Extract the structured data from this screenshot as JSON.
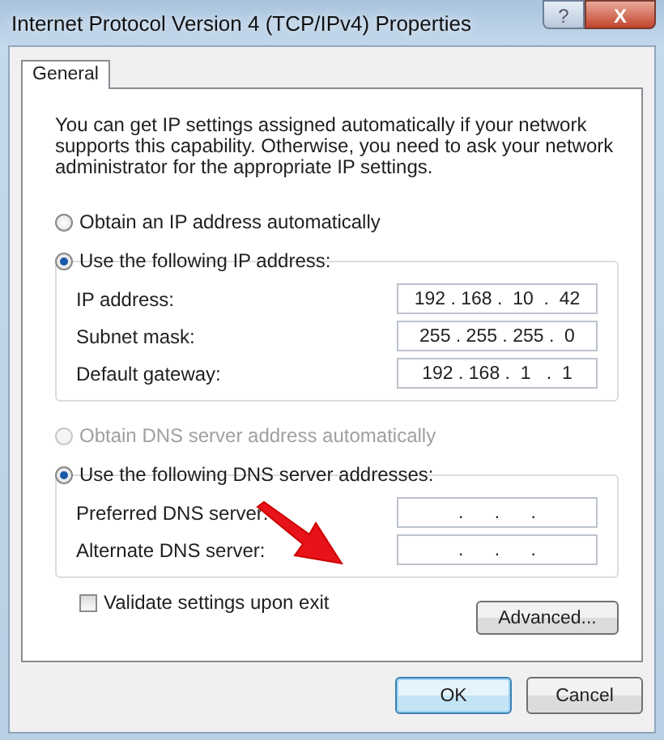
{
  "window": {
    "title": "Internet Protocol Version 4 (TCP/IPv4) Properties",
    "help": "?",
    "close": "X"
  },
  "tabs": [
    {
      "label": "General",
      "selected": true
    }
  ],
  "intro": "You can get IP settings assigned automatically if your network supports this capability. Otherwise, you need to ask your network administrator for the appropriate IP settings.",
  "sections": [
    {
      "auto_option": {
        "label": "Obtain an IP address automatically",
        "selected": false,
        "disabled": false
      },
      "manual_option": {
        "label": "Use the following IP address:",
        "selected": true
      },
      "fields": [
        {
          "label": "IP address:",
          "value": "192 . 168 .  10  .  42"
        },
        {
          "label": "Subnet mask:",
          "value": "255 . 255 . 255 .  0"
        },
        {
          "label": "Default gateway:",
          "value": "192 . 168 .  1   .  1"
        }
      ]
    },
    {
      "auto_option": {
        "label": "Obtain DNS server address automatically",
        "selected": false,
        "disabled": true
      },
      "manual_option": {
        "label": "Use the following DNS server addresses:",
        "selected": true
      },
      "fields": [
        {
          "label": "Preferred DNS server:",
          "value": ".      .      ."
        },
        {
          "label": "Alternate DNS server:",
          "value": ".      .      ."
        }
      ]
    }
  ],
  "validate": {
    "label": "Validate settings upon exit",
    "checked": false
  },
  "advanced_button": "Advanced...",
  "buttons": [
    {
      "label": "OK",
      "default": true
    },
    {
      "label": "Cancel",
      "default": false
    }
  ]
}
